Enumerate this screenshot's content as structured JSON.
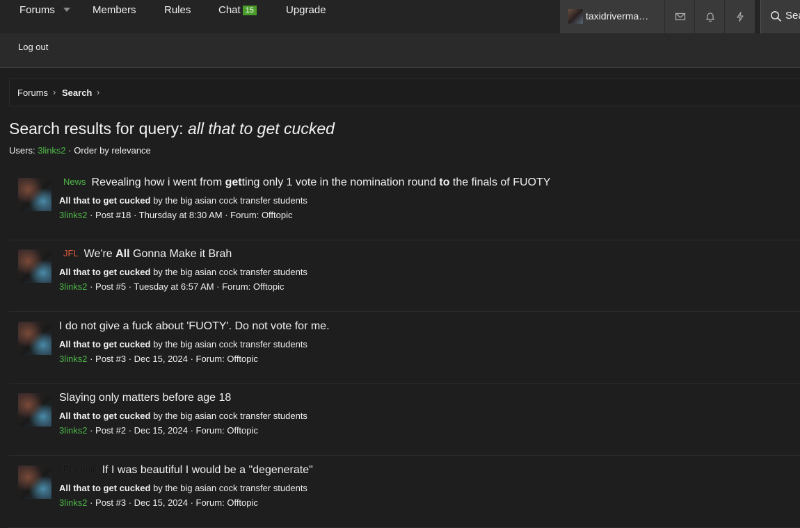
{
  "nav": {
    "items": [
      {
        "label": "Forums"
      },
      {
        "label": "Members"
      },
      {
        "label": "Rules"
      },
      {
        "label": "Chat",
        "badge": "15"
      },
      {
        "label": "Upgrade"
      }
    ],
    "username": "taxidriverma…",
    "search_label": "Sea",
    "logout": "Log out",
    "icons": [
      "envelope-icon",
      "bell-icon",
      "bolt-icon",
      "search-icon"
    ]
  },
  "breadcrumb": {
    "items": [
      "Forums",
      "Search"
    ],
    "separator": "›"
  },
  "page": {
    "title_prefix": "Search results for query: ",
    "query": "all that to get cucked",
    "users_label": "Users:",
    "user": "3links2",
    "order": "· Order by relevance"
  },
  "results": [
    {
      "prefix": "News",
      "title_parts": [
        "Revealing how i went from ",
        "get",
        "ting only 1 vote in the nomination round ",
        "to",
        " the finals of FUOTY"
      ],
      "snippet_bold": "All that to get cucked",
      "snippet_rest": " by the big asian cock transfer students",
      "author": "3links2",
      "meta_rest": " · Post #18 · Thursday at 8:30 AM · Forum: Offtopic"
    },
    {
      "prefix": "JFL",
      "title_parts": [
        "We're ",
        "All",
        " Gonna Make it Brah"
      ],
      "snippet_bold": "All that to get cucked",
      "snippet_rest": " by the big asian cock transfer students",
      "author": "3links2",
      "meta_rest": " · Post #5 · Tuesday at 6:57 AM · Forum: Offtopic"
    },
    {
      "title": "I do not give a fuck about 'FUOTY'. Do not vote for me.",
      "snippet_bold": "All that to get cucked",
      "snippet_rest": " by the big asian cock transfer students",
      "author": "3links2",
      "meta_rest": " · Post #3 · Dec 15, 2024 · Forum: Offtopic"
    },
    {
      "title": "Slaying only matters before age 18",
      "snippet_bold": "All that to get cucked",
      "snippet_rest": " by the big asian cock transfer students",
      "author": "3links2",
      "meta_rest": " · Post #2 · Dec 15, 2024 · Forum: Offtopic"
    },
    {
      "prefix": "Blackpill",
      "title": "If I was beautiful I would be a \"degenerate\"",
      "snippet_bold": "All that to get cucked",
      "snippet_rest": " by the big asian cock transfer students",
      "author": "3links2",
      "meta_rest": " · Post #3 · Dec 15, 2024 · Forum: Offtopic"
    }
  ],
  "colors": {
    "accent_green": "#4fb84a",
    "prefix_jfl": "#e05a3a",
    "badge_green": "#4a9c2b"
  }
}
